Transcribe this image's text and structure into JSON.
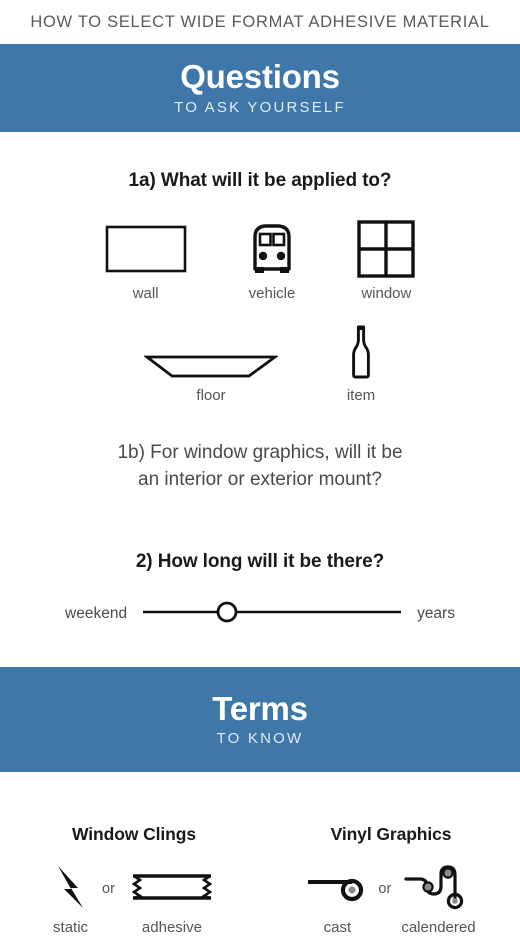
{
  "header": {
    "title": "HOW TO SELECT WIDE FORMAT ADHESIVE MATERIAL"
  },
  "colors": {
    "banner_blue": "#3f77a8",
    "banner_title": "#ffffff",
    "banner_subtitle": "#e2ecf4",
    "ink": "#1a1a1a",
    "label_gray": "#555555",
    "roller_fill": "#8c8c8c"
  },
  "questions_banner": {
    "title": "Questions",
    "subtitle": "TO ASK YOURSELF"
  },
  "question_1a": {
    "heading": "1a) What will it be applied to?",
    "options_row1": [
      {
        "label": "wall",
        "icon": "wall-icon"
      },
      {
        "label": "vehicle",
        "icon": "vehicle-icon"
      },
      {
        "label": "window",
        "icon": "window-icon"
      }
    ],
    "options_row2": [
      {
        "label": "floor",
        "icon": "floor-icon"
      },
      {
        "label": "item",
        "icon": "item-bottle-icon"
      }
    ]
  },
  "question_1b": {
    "line1": "1b) For window graphics, will it be",
    "line2": "an interior or exterior mount?"
  },
  "question_2": {
    "heading": "2) How long will it be there?",
    "slider": {
      "left_label": "weekend",
      "right_label": "years",
      "knob_position_percent": 33
    }
  },
  "terms_banner": {
    "title": "Terms",
    "subtitle": "TO KNOW"
  },
  "terms": [
    {
      "title": "Window Clings",
      "separator": "or",
      "items": [
        {
          "label": "static",
          "icon": "lightning-bolt-icon"
        },
        {
          "label": "adhesive",
          "icon": "adhesive-tape-icon"
        }
      ]
    },
    {
      "title": "Vinyl Graphics",
      "separator": "or",
      "items": [
        {
          "label": "cast",
          "icon": "cast-roll-icon"
        },
        {
          "label": "calendered",
          "icon": "calender-rollers-icon"
        }
      ]
    }
  ]
}
